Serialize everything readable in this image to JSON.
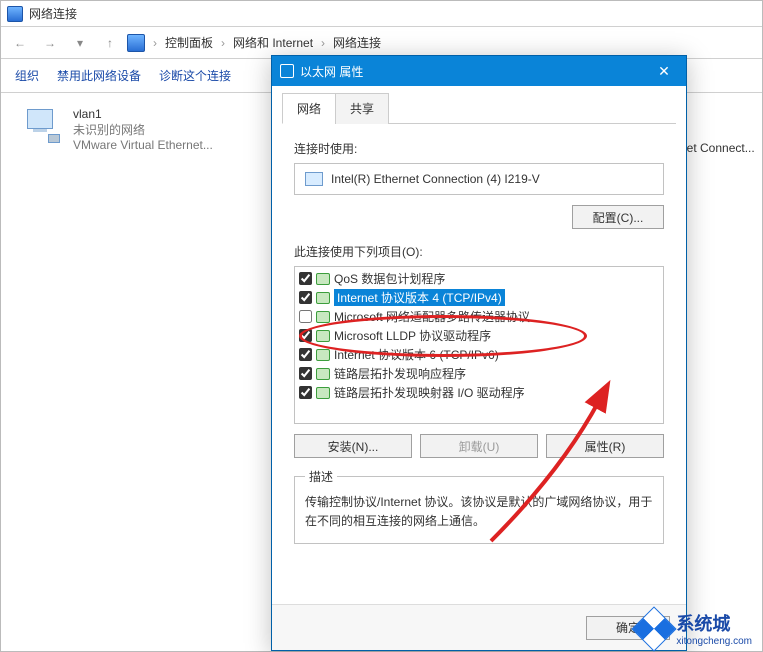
{
  "bg_window": {
    "title": "网络连接",
    "breadcrumb": [
      "控制面板",
      "网络和 Internet",
      "网络连接"
    ],
    "toolbar": {
      "organize": "组织",
      "disable": "禁用此网络设备",
      "diagnose_prefix": "诊断这个连接"
    },
    "vlan": {
      "name": "vlan1",
      "status": "未识别的网络",
      "adapter": "VMware Virtual Ethernet..."
    },
    "side_cut": "net Connect..."
  },
  "dialog": {
    "title": "以太网 属性",
    "tabs": {
      "network": "网络",
      "sharing": "共享"
    },
    "connect_using_label": "连接时使用:",
    "adapter": "Intel(R) Ethernet Connection (4) I219-V",
    "configure_btn": "配置(C)...",
    "items_label": "此连接使用下列项目(O):",
    "items": [
      {
        "checked": true,
        "label": "QoS 数据包计划程序",
        "overflow_top": true
      },
      {
        "checked": true,
        "label": "Internet 协议版本 4 (TCP/IPv4)",
        "selected": true
      },
      {
        "checked": false,
        "label": "Microsoft 网络适配器多路传送器协议"
      },
      {
        "checked": true,
        "label": "Microsoft LLDP 协议驱动程序"
      },
      {
        "checked": true,
        "label": "Internet 协议版本 6 (TCP/IPv6)"
      },
      {
        "checked": true,
        "label": "链路层拓扑发现响应程序"
      },
      {
        "checked": true,
        "label": "链路层拓扑发现映射器 I/O 驱动程序"
      }
    ],
    "install_btn": "安装(N)...",
    "uninstall_btn": "卸载(U)",
    "props_btn": "属性(R)",
    "desc_legend": "描述",
    "desc_text": "传输控制协议/Internet 协议。该协议是默认的广域网络协议，用于在不同的相互连接的网络上通信。",
    "ok_btn": "确定"
  },
  "watermark": {
    "name": "系统城",
    "url": "xitongcheng.com"
  }
}
